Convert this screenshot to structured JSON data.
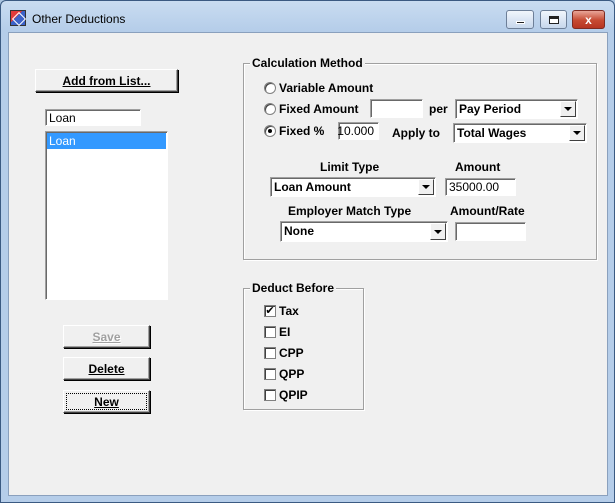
{
  "window": {
    "title": "Other Deductions",
    "close_glyph": "x"
  },
  "left": {
    "add_from_list_label": "Add from List...",
    "selected_name": "Loan",
    "list_items": [
      "Loan"
    ],
    "save_label": "Save",
    "delete_label": "Delete",
    "new_label": "New"
  },
  "calculation": {
    "legend": "Calculation Method",
    "variable_amount_label": "Variable Amount",
    "fixed_amount_label": "Fixed Amount",
    "fixed_amount_value": "",
    "per_label": "per",
    "per_value": "Pay Period",
    "fixed_pct_label": "Fixed %",
    "fixed_pct_value": "10.000",
    "apply_to_label": "Apply to",
    "apply_to_value": "Total Wages",
    "selected_method": "Fixed %",
    "limit_type_label": "Limit Type",
    "limit_type_value": "Loan Amount",
    "amount_label": "Amount",
    "amount_value": "35000.00",
    "employer_match_label": "Employer Match Type",
    "employer_match_value": "None",
    "amount_rate_label": "Amount/Rate",
    "amount_rate_value": ""
  },
  "deduct_before": {
    "legend": "Deduct Before",
    "items": [
      {
        "label": "Tax",
        "checked": true
      },
      {
        "label": "EI",
        "checked": false
      },
      {
        "label": "CPP",
        "checked": false
      },
      {
        "label": "QPP",
        "checked": false
      },
      {
        "label": "QPIP",
        "checked": false
      }
    ],
    "check_glyph": "✔"
  }
}
